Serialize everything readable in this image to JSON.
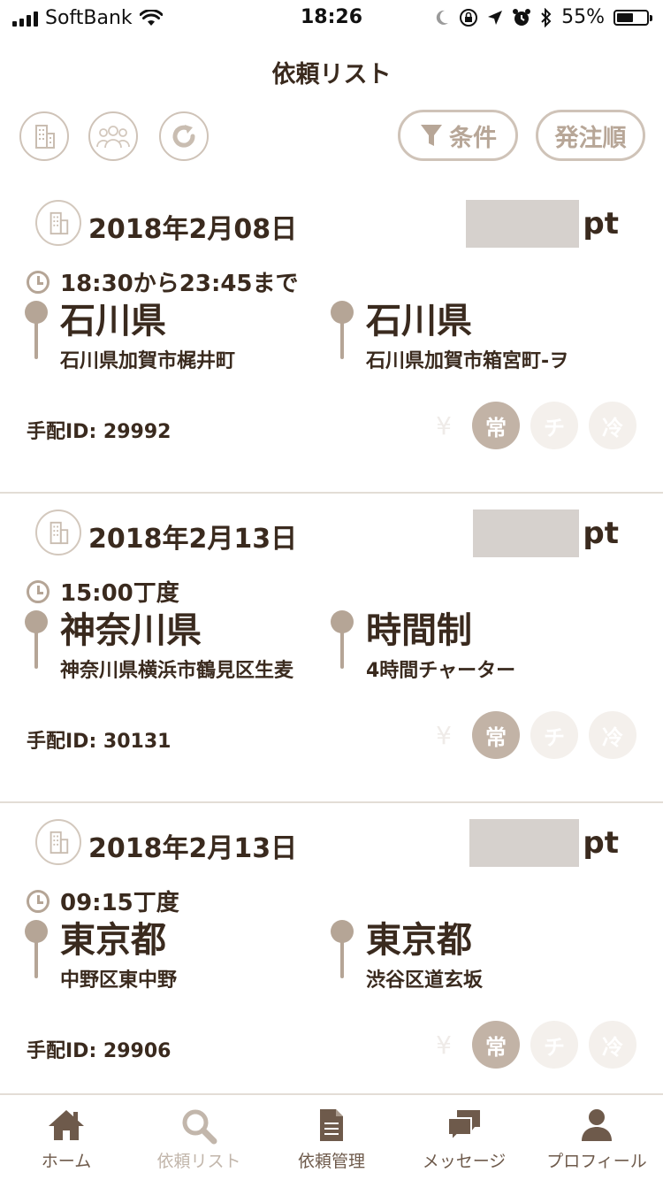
{
  "status_bar": {
    "carrier": "SoftBank",
    "time": "18:26",
    "battery": "55%",
    "battery_fraction": 0.55,
    "icons": [
      "signal-icon",
      "wifi-icon",
      "moon-icon",
      "rotation-lock-icon",
      "location-icon",
      "alarm-icon",
      "bluetooth-icon",
      "battery-icon"
    ]
  },
  "nav": {
    "title": "依頼リスト"
  },
  "toolbar": {
    "filter_label": "条件",
    "sort_label": "発注順",
    "icons": [
      "building-icon",
      "group-icon",
      "refresh-icon",
      "funnel-icon"
    ]
  },
  "orders": [
    {
      "date": "2018年2月08日",
      "points_unit": "pt",
      "time": "18:30から23:45まで",
      "from": {
        "main": "石川県",
        "sub": "石川県加賀市梶井町"
      },
      "to": {
        "main": "石川県",
        "sub": "石川県加賀市箱宮町-ヲ"
      },
      "order_id": "手配ID: 29992",
      "yen": "¥",
      "badges": [
        {
          "label": "常",
          "active": true
        },
        {
          "label": "チ",
          "active": false
        },
        {
          "label": "冷",
          "active": false
        }
      ]
    },
    {
      "date": "2018年2月13日",
      "points_unit": "pt",
      "time": "15:00丁度",
      "from": {
        "main": "神奈川県",
        "sub": "神奈川県横浜市鶴見区生麦"
      },
      "to": {
        "main": "時間制",
        "sub": "4時間チャーター"
      },
      "order_id": "手配ID: 30131",
      "yen": "¥",
      "badges": [
        {
          "label": "常",
          "active": true
        },
        {
          "label": "チ",
          "active": false
        },
        {
          "label": "冷",
          "active": false
        }
      ]
    },
    {
      "date": "2018年2月13日",
      "points_unit": "pt",
      "time": "09:15丁度",
      "from": {
        "main": "東京都",
        "sub": "中野区東中野"
      },
      "to": {
        "main": "東京都",
        "sub": "渋谷区道玄坂"
      },
      "order_id": "手配ID: 29906",
      "yen": "¥",
      "badges": [
        {
          "label": "常",
          "active": true
        },
        {
          "label": "チ",
          "active": false
        },
        {
          "label": "冷",
          "active": false
        }
      ]
    }
  ],
  "tabs": [
    {
      "label": "ホーム",
      "icon": "home-icon",
      "active": false
    },
    {
      "label": "依頼リスト",
      "icon": "search-icon",
      "active": true
    },
    {
      "label": "依頼管理",
      "icon": "document-icon",
      "active": false
    },
    {
      "label": "メッセージ",
      "icon": "chat-icon",
      "active": false
    },
    {
      "label": "プロフィール",
      "icon": "person-icon",
      "active": false
    }
  ],
  "colors": {
    "text": "#3a2a1e",
    "accent": "#b5a596",
    "badge_active": "#c2b3a6",
    "badge_inactive": "#f4f0ec",
    "tab_inactive": "#6e5a4b",
    "tab_active": "#c2b6ab"
  }
}
